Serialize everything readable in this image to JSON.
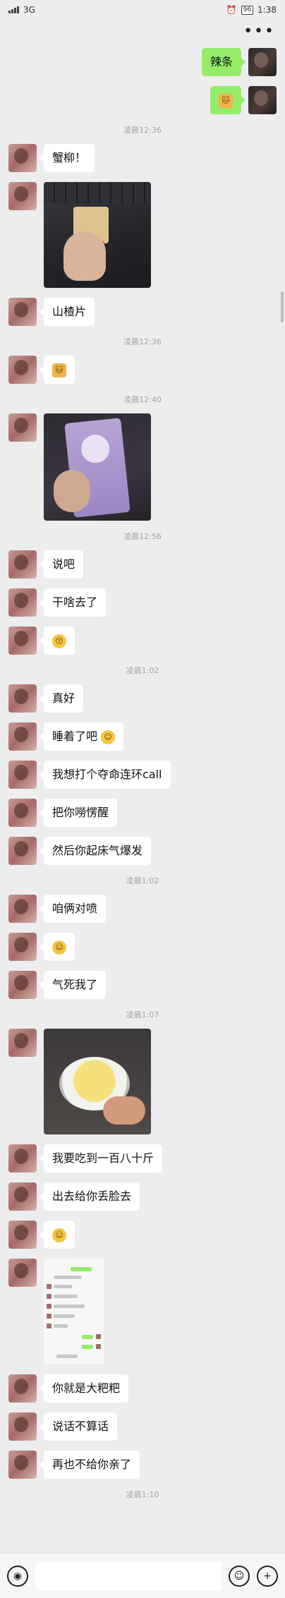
{
  "statusbar": {
    "carrier": "",
    "net": "3G",
    "battery": "96",
    "time": "1:38"
  },
  "header": {
    "more_label": "•••"
  },
  "timestamps": {
    "t1": "凌晨12:36",
    "t2": "凌晨12:36",
    "t3": "凌晨12:40",
    "t4": "凌晨12:56",
    "t5": "凌晨1:02",
    "t6": "凌晨1:02",
    "t7": "凌晨1:07",
    "t8": "凌晨1:10"
  },
  "messages": {
    "m_lati": "辣条",
    "m_xieliu": "蟹柳！",
    "m_shanzha": "山楂片",
    "m_shuoba": "说吧",
    "m_ganshaqu": "干啥去了",
    "m_zhenhao": "真好",
    "m_shuizhaole": "睡着了吧",
    "m_call": "我想打个夺命连环call",
    "m_laosing": "把你嘮愣醒",
    "m_qichuang": "然后你起床气爆发",
    "m_duipen": "咱俩对喷",
    "m_qisi": "气死我了",
    "m_chidao": "我要吃到一百八十斤",
    "m_diulian": "出去给你丢脸去",
    "m_dababa": "你就是大粑粑",
    "m_suanhua": "说话不算话",
    "m_buqin": "再也不给你亲了"
  },
  "emoji": {
    "smile": "☺",
    "cat": "🐱",
    "kiss": "😚"
  },
  "input": {
    "value": "",
    "placeholder": ""
  }
}
